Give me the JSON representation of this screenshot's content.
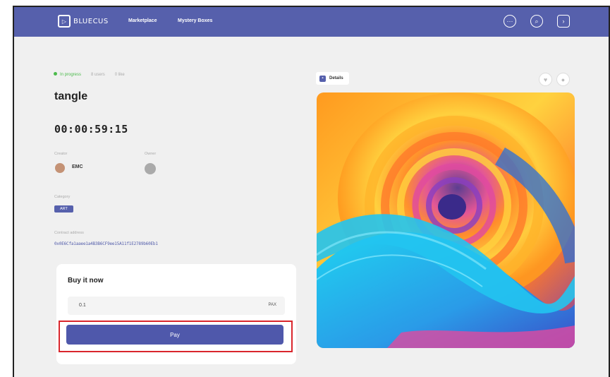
{
  "nav": {
    "brand": "BLUECUS",
    "links": [
      "Marketplace",
      "Mystery Boxes"
    ],
    "icons": [
      "more-icon",
      "search-icon",
      "login-icon"
    ]
  },
  "item": {
    "status": "In progress",
    "meta": [
      "8 users",
      "0 like"
    ],
    "title": "tangle",
    "timer": "00:00:59:15",
    "creator_label": "Creator",
    "creator_name": "EMC",
    "owner_label": "Owner",
    "category_label": "Category",
    "category": "ART",
    "contract_label": "Contract address",
    "contract_address": "0x0E6Cfa1aaee1a4B3B6CF9ee15A11f1E2789b60Eb1"
  },
  "buy": {
    "title": "Buy it now",
    "amount": "0.1",
    "unit": "PAX",
    "pay_label": "Pay"
  },
  "details": {
    "label": "Details"
  },
  "colors": {
    "primary": "#5660ac",
    "highlight": "#d9262c",
    "status_live": "#4cbb4c"
  }
}
